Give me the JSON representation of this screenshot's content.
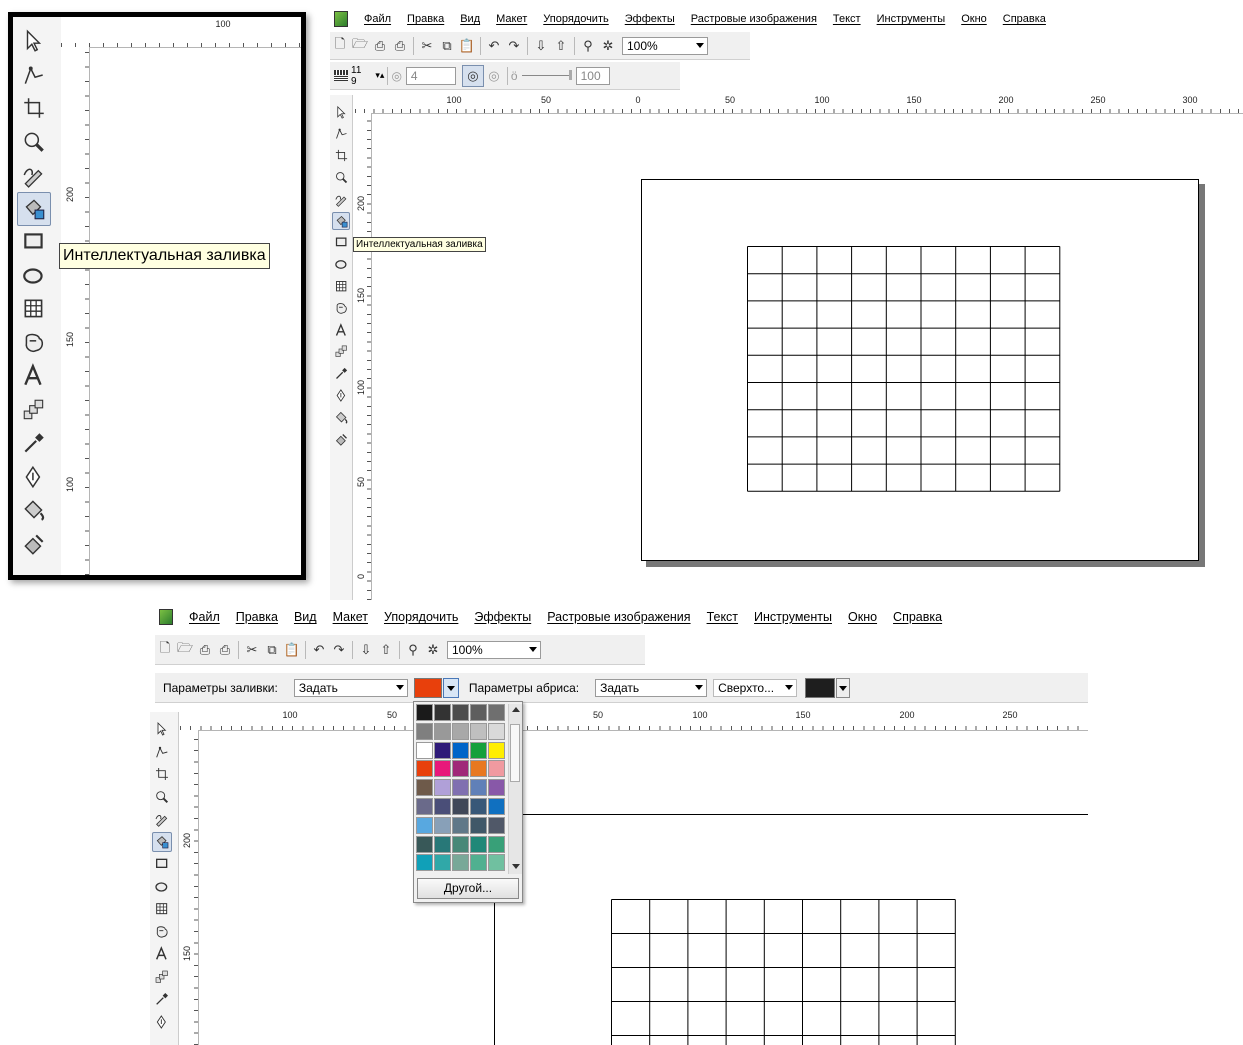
{
  "menu": [
    "Файл",
    "Правка",
    "Вид",
    "Макет",
    "Упорядочить",
    "Эффекты",
    "Растровые изображения",
    "Текст",
    "Инструменты",
    "Окно",
    "Справка"
  ],
  "zoom": "100%",
  "tooltip": "Интеллектуальная заливка",
  "toolbox_icons": [
    "pick-tool-icon",
    "shape-tool-icon",
    "crop-tool-icon",
    "zoom-tool-icon",
    "freehand-tool-icon",
    "smart-fill-tool-icon",
    "rectangle-tool-icon",
    "ellipse-tool-icon",
    "graph-paper-tool-icon",
    "basic-shapes-tool-icon",
    "text-tool-icon",
    "interactive-blend-tool-icon",
    "eyedropper-tool-icon",
    "outline-pen-tool-icon",
    "fill-tool-icon",
    "interactive-fill-tool-icon"
  ],
  "property_bar_top": {
    "cols": "11",
    "rows": "9",
    "spiral_revs": "4",
    "expansion": "100"
  },
  "property_bar_bottom": {
    "fill_label": "Параметры заливки:",
    "fill_value": "Задать",
    "fill_color": "#e8400c",
    "outline_label": "Параметры абриса:",
    "outline_value": "Задать",
    "outline_width": "Сверхто...",
    "outline_color": "#1e1e1e"
  },
  "color_picker": {
    "swatches": [
      [
        "#1a1a1a",
        "#333333",
        "#4d4d4d",
        "#5e5e5e",
        "#6f6f6f"
      ],
      [
        "#7f7f7f",
        "#999999",
        "#a8a8a8",
        "#bfbfbf",
        "#d9d9d9"
      ],
      [
        "#ffffff",
        "#2e1a78",
        "#0064c8",
        "#15a03c",
        "#ffee00"
      ],
      [
        "#e8400c",
        "#e8187a",
        "#a02878",
        "#e87820",
        "#f09aa0"
      ],
      [
        "#6e5a4a",
        "#b0a0d8",
        "#8070b0",
        "#6080b8",
        "#8858a8"
      ],
      [
        "#6a6a8a",
        "#4a4e78",
        "#404858",
        "#385878",
        "#1070c0"
      ],
      [
        "#58a8e0",
        "#88a0b8",
        "#607888",
        "#405868",
        "#505868"
      ],
      [
        "#385858",
        "#287878",
        "#488878",
        "#208878",
        "#38a078"
      ],
      [
        "#10a0b8",
        "#30a8a8",
        "#78a898",
        "#50b090",
        "#70c0a0"
      ]
    ],
    "other_button": "Другой..."
  },
  "rulers": {
    "zoom_h": [
      "100"
    ],
    "zoom_v": [
      "200",
      "150",
      "100"
    ],
    "top_h": [
      "100",
      "50",
      "0",
      "50",
      "100",
      "150",
      "200",
      "250",
      "300"
    ],
    "top_v": [
      "200",
      "150",
      "100",
      "50",
      "0"
    ],
    "bottom_h": [
      "100",
      "50",
      "50",
      "100",
      "150",
      "200",
      "250"
    ],
    "bottom_v": [
      "200",
      "150"
    ]
  }
}
